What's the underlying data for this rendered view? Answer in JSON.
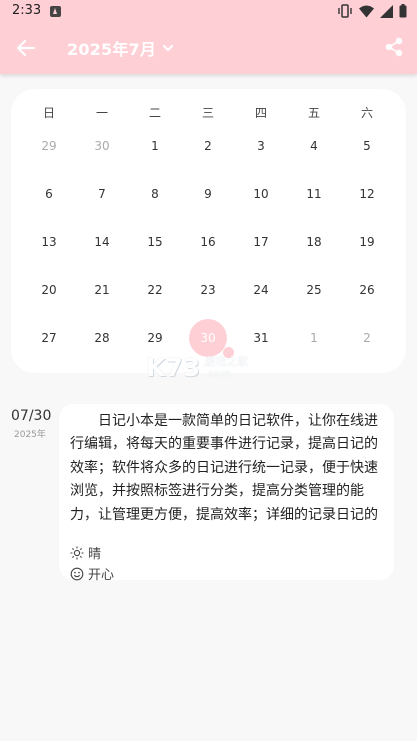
{
  "status_bar": {
    "time": "2:33"
  },
  "header": {
    "title": "2025年7月",
    "accent": "#ffcfd6",
    "icons": [
      "back-arrow-icon",
      "chevron-down-icon",
      "share-icon"
    ]
  },
  "calendar": {
    "weekdays": [
      "日",
      "一",
      "二",
      "三",
      "四",
      "五",
      "六"
    ],
    "weeks": [
      [
        "29",
        "30",
        "1",
        "2",
        "3",
        "4",
        "5"
      ],
      [
        "6",
        "7",
        "8",
        "9",
        "10",
        "11",
        "12"
      ],
      [
        "13",
        "14",
        "15",
        "16",
        "17",
        "18",
        "19"
      ],
      [
        "20",
        "21",
        "22",
        "23",
        "24",
        "25",
        "26"
      ],
      [
        "27",
        "28",
        "29",
        "30",
        "31",
        "1",
        "2"
      ]
    ],
    "selected_day": "30"
  },
  "entry": {
    "date": "07/30",
    "year": "2025年",
    "text": "日记小本是一款简单的日记软件，让你在线进行编辑，将每天的重要事件进行记录，提高日记的效率；软件将众多的日记进行统一记录，便于快速浏览，并按照标签进行分类，提高分类管理的能力，让管理更方便，提高效率；详细的记录日记的信息，知道具体的内容，便于快速浏览，让浏览更便捷，并…",
    "weather": "晴",
    "mood": "开心"
  },
  "watermark": {
    "logo": "K73",
    "line1": "游戏之家",
    "line2": ".com"
  }
}
